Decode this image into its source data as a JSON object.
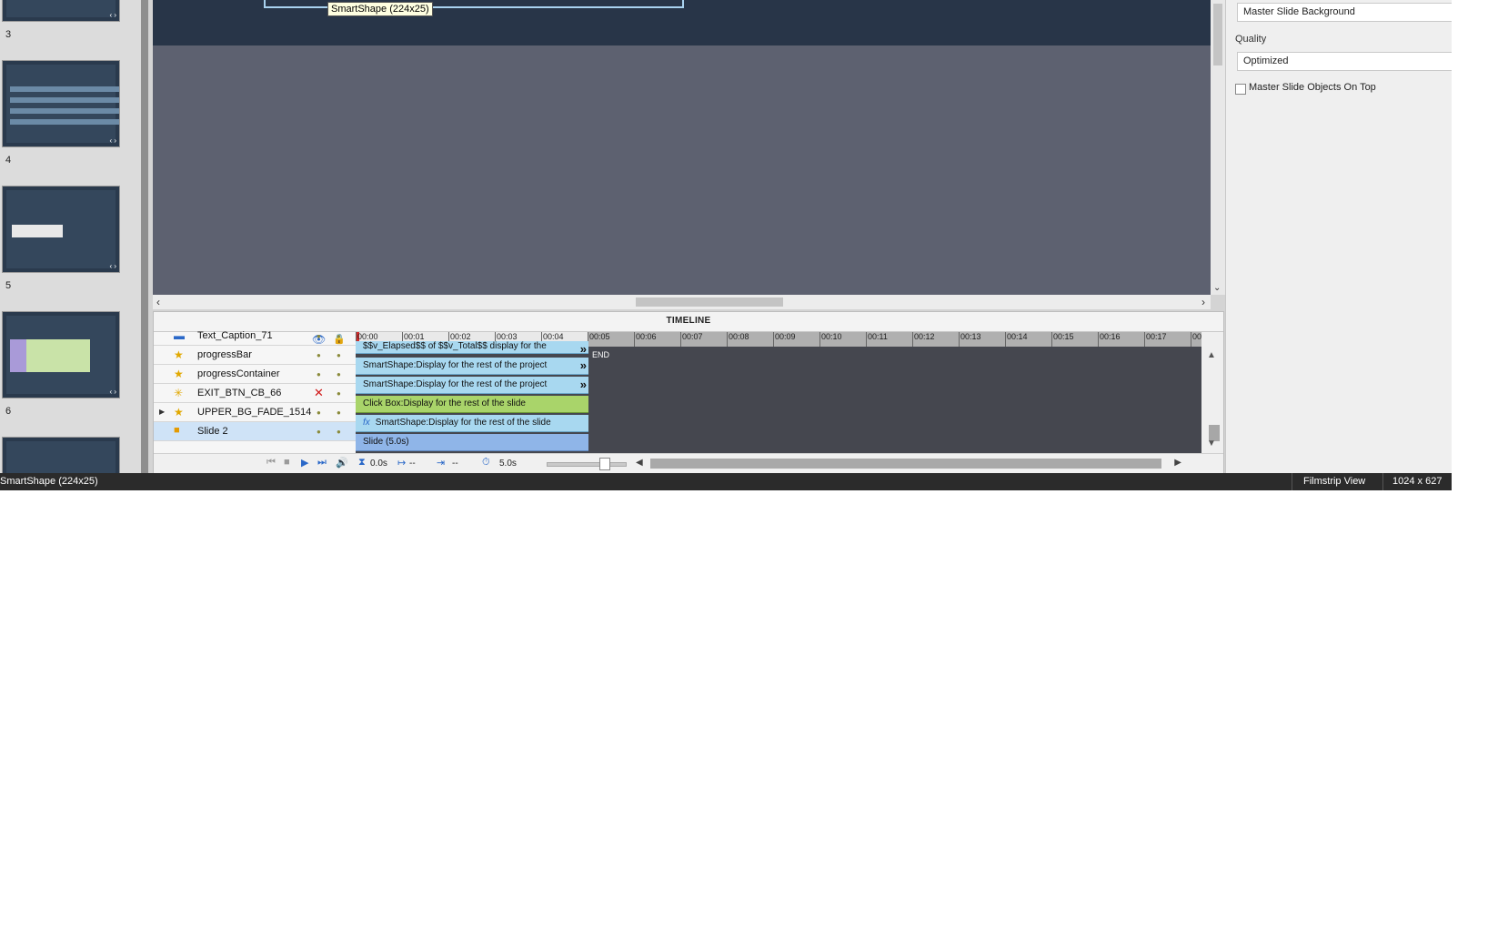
{
  "filmstrip": {
    "slides": [
      {
        "number": "3"
      },
      {
        "number": "4"
      },
      {
        "number": "5"
      },
      {
        "number": "6"
      }
    ]
  },
  "stage": {
    "tooltip": "SmartShape (224x25)"
  },
  "properties": {
    "background_value": "Master Slide Background",
    "quality_label": "Quality",
    "quality_value": "Optimized",
    "master_objects_label": "Master Slide Objects On Top"
  },
  "timeline": {
    "title": "TIMELINE",
    "ruler": [
      "00:00",
      "00:01",
      "00:02",
      "00:03",
      "00:04",
      "00:05",
      "00:06",
      "00:07",
      "00:08",
      "00:09",
      "00:10",
      "00:11",
      "00:12",
      "00:13",
      "00:14",
      "00:15",
      "00:16",
      "00:17",
      "00:"
    ],
    "end_label": "END",
    "layers": [
      {
        "name": "Text_Caption_71",
        "bar": "$$v_Elapsed$$ of $$v_Total$$ display for the"
      },
      {
        "name": "progressBar",
        "bar": "SmartShape:Display for the rest of the project"
      },
      {
        "name": "progressContainer",
        "bar": "SmartShape:Display for the rest of the project"
      },
      {
        "name": "EXIT_BTN_CB_66",
        "bar": "Click Box:Display for the rest of the slide"
      },
      {
        "name": "UPPER_BG_FADE_1514",
        "bar": "SmartShape:Display for the rest of the slide"
      },
      {
        "name": "Slide 2",
        "bar": "Slide (5.0s)"
      }
    ],
    "footer": {
      "start_time": "0.0s",
      "in_value": "--",
      "duration_value": "--",
      "slide_duration": "5.0s"
    }
  },
  "statusbar": {
    "selection": "SmartShape (224x25)",
    "view_mode": "Filmstrip View",
    "resolution": "1024 x 627"
  }
}
